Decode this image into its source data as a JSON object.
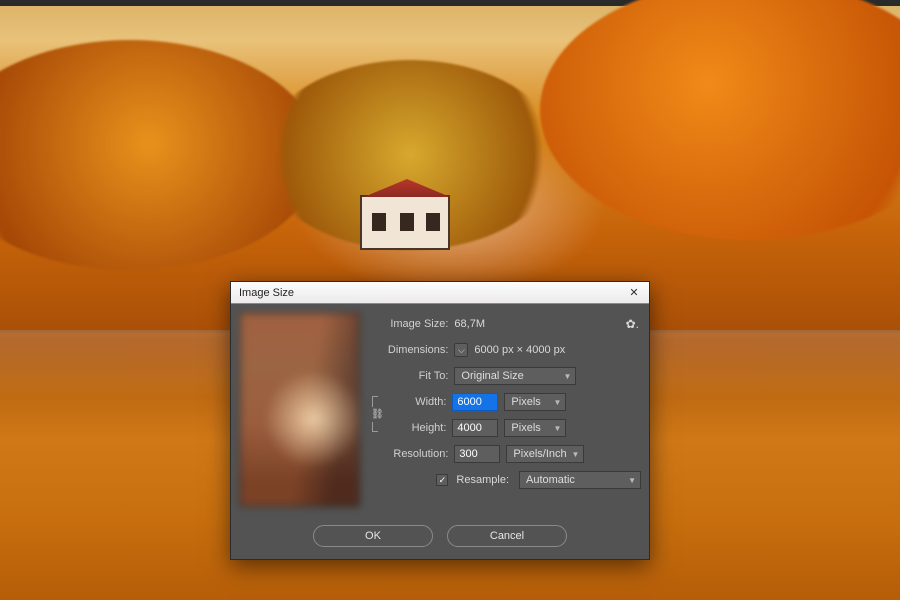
{
  "dialog": {
    "title": "Image Size",
    "image_size_label": "Image Size:",
    "image_size_value": "68,7M",
    "dimensions_label": "Dimensions:",
    "dimensions_value": "6000 px × 4000 px",
    "fit_to_label": "Fit To:",
    "fit_to_value": "Original Size",
    "width_label": "Width:",
    "width_value": "6000",
    "width_unit": "Pixels",
    "height_label": "Height:",
    "height_value": "4000",
    "height_unit": "Pixels",
    "resolution_label": "Resolution:",
    "resolution_value": "300",
    "resolution_unit": "Pixels/Inch",
    "resample_label": "Resample:",
    "resample_checked": "✓",
    "resample_value": "Automatic",
    "ok_label": "OK",
    "cancel_label": "Cancel"
  }
}
